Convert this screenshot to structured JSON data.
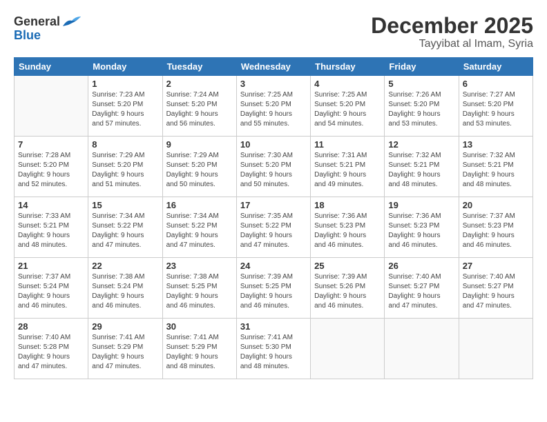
{
  "header": {
    "logo_general": "General",
    "logo_blue": "Blue",
    "main_title": "December 2025",
    "subtitle": "Tayyibat al Imam, Syria"
  },
  "calendar": {
    "days_of_week": [
      "Sunday",
      "Monday",
      "Tuesday",
      "Wednesday",
      "Thursday",
      "Friday",
      "Saturday"
    ],
    "weeks": [
      [
        {
          "day": "",
          "info": ""
        },
        {
          "day": "1",
          "info": "Sunrise: 7:23 AM\nSunset: 5:20 PM\nDaylight: 9 hours\nand 57 minutes."
        },
        {
          "day": "2",
          "info": "Sunrise: 7:24 AM\nSunset: 5:20 PM\nDaylight: 9 hours\nand 56 minutes."
        },
        {
          "day": "3",
          "info": "Sunrise: 7:25 AM\nSunset: 5:20 PM\nDaylight: 9 hours\nand 55 minutes."
        },
        {
          "day": "4",
          "info": "Sunrise: 7:25 AM\nSunset: 5:20 PM\nDaylight: 9 hours\nand 54 minutes."
        },
        {
          "day": "5",
          "info": "Sunrise: 7:26 AM\nSunset: 5:20 PM\nDaylight: 9 hours\nand 53 minutes."
        },
        {
          "day": "6",
          "info": "Sunrise: 7:27 AM\nSunset: 5:20 PM\nDaylight: 9 hours\nand 53 minutes."
        }
      ],
      [
        {
          "day": "7",
          "info": "Sunrise: 7:28 AM\nSunset: 5:20 PM\nDaylight: 9 hours\nand 52 minutes."
        },
        {
          "day": "8",
          "info": "Sunrise: 7:29 AM\nSunset: 5:20 PM\nDaylight: 9 hours\nand 51 minutes."
        },
        {
          "day": "9",
          "info": "Sunrise: 7:29 AM\nSunset: 5:20 PM\nDaylight: 9 hours\nand 50 minutes."
        },
        {
          "day": "10",
          "info": "Sunrise: 7:30 AM\nSunset: 5:20 PM\nDaylight: 9 hours\nand 50 minutes."
        },
        {
          "day": "11",
          "info": "Sunrise: 7:31 AM\nSunset: 5:21 PM\nDaylight: 9 hours\nand 49 minutes."
        },
        {
          "day": "12",
          "info": "Sunrise: 7:32 AM\nSunset: 5:21 PM\nDaylight: 9 hours\nand 48 minutes."
        },
        {
          "day": "13",
          "info": "Sunrise: 7:32 AM\nSunset: 5:21 PM\nDaylight: 9 hours\nand 48 minutes."
        }
      ],
      [
        {
          "day": "14",
          "info": "Sunrise: 7:33 AM\nSunset: 5:21 PM\nDaylight: 9 hours\nand 48 minutes."
        },
        {
          "day": "15",
          "info": "Sunrise: 7:34 AM\nSunset: 5:22 PM\nDaylight: 9 hours\nand 47 minutes."
        },
        {
          "day": "16",
          "info": "Sunrise: 7:34 AM\nSunset: 5:22 PM\nDaylight: 9 hours\nand 47 minutes."
        },
        {
          "day": "17",
          "info": "Sunrise: 7:35 AM\nSunset: 5:22 PM\nDaylight: 9 hours\nand 47 minutes."
        },
        {
          "day": "18",
          "info": "Sunrise: 7:36 AM\nSunset: 5:23 PM\nDaylight: 9 hours\nand 46 minutes."
        },
        {
          "day": "19",
          "info": "Sunrise: 7:36 AM\nSunset: 5:23 PM\nDaylight: 9 hours\nand 46 minutes."
        },
        {
          "day": "20",
          "info": "Sunrise: 7:37 AM\nSunset: 5:23 PM\nDaylight: 9 hours\nand 46 minutes."
        }
      ],
      [
        {
          "day": "21",
          "info": "Sunrise: 7:37 AM\nSunset: 5:24 PM\nDaylight: 9 hours\nand 46 minutes."
        },
        {
          "day": "22",
          "info": "Sunrise: 7:38 AM\nSunset: 5:24 PM\nDaylight: 9 hours\nand 46 minutes."
        },
        {
          "day": "23",
          "info": "Sunrise: 7:38 AM\nSunset: 5:25 PM\nDaylight: 9 hours\nand 46 minutes."
        },
        {
          "day": "24",
          "info": "Sunrise: 7:39 AM\nSunset: 5:25 PM\nDaylight: 9 hours\nand 46 minutes."
        },
        {
          "day": "25",
          "info": "Sunrise: 7:39 AM\nSunset: 5:26 PM\nDaylight: 9 hours\nand 46 minutes."
        },
        {
          "day": "26",
          "info": "Sunrise: 7:40 AM\nSunset: 5:27 PM\nDaylight: 9 hours\nand 47 minutes."
        },
        {
          "day": "27",
          "info": "Sunrise: 7:40 AM\nSunset: 5:27 PM\nDaylight: 9 hours\nand 47 minutes."
        }
      ],
      [
        {
          "day": "28",
          "info": "Sunrise: 7:40 AM\nSunset: 5:28 PM\nDaylight: 9 hours\nand 47 minutes."
        },
        {
          "day": "29",
          "info": "Sunrise: 7:41 AM\nSunset: 5:29 PM\nDaylight: 9 hours\nand 47 minutes."
        },
        {
          "day": "30",
          "info": "Sunrise: 7:41 AM\nSunset: 5:29 PM\nDaylight: 9 hours\nand 48 minutes."
        },
        {
          "day": "31",
          "info": "Sunrise: 7:41 AM\nSunset: 5:30 PM\nDaylight: 9 hours\nand 48 minutes."
        },
        {
          "day": "",
          "info": ""
        },
        {
          "day": "",
          "info": ""
        },
        {
          "day": "",
          "info": ""
        }
      ]
    ]
  }
}
